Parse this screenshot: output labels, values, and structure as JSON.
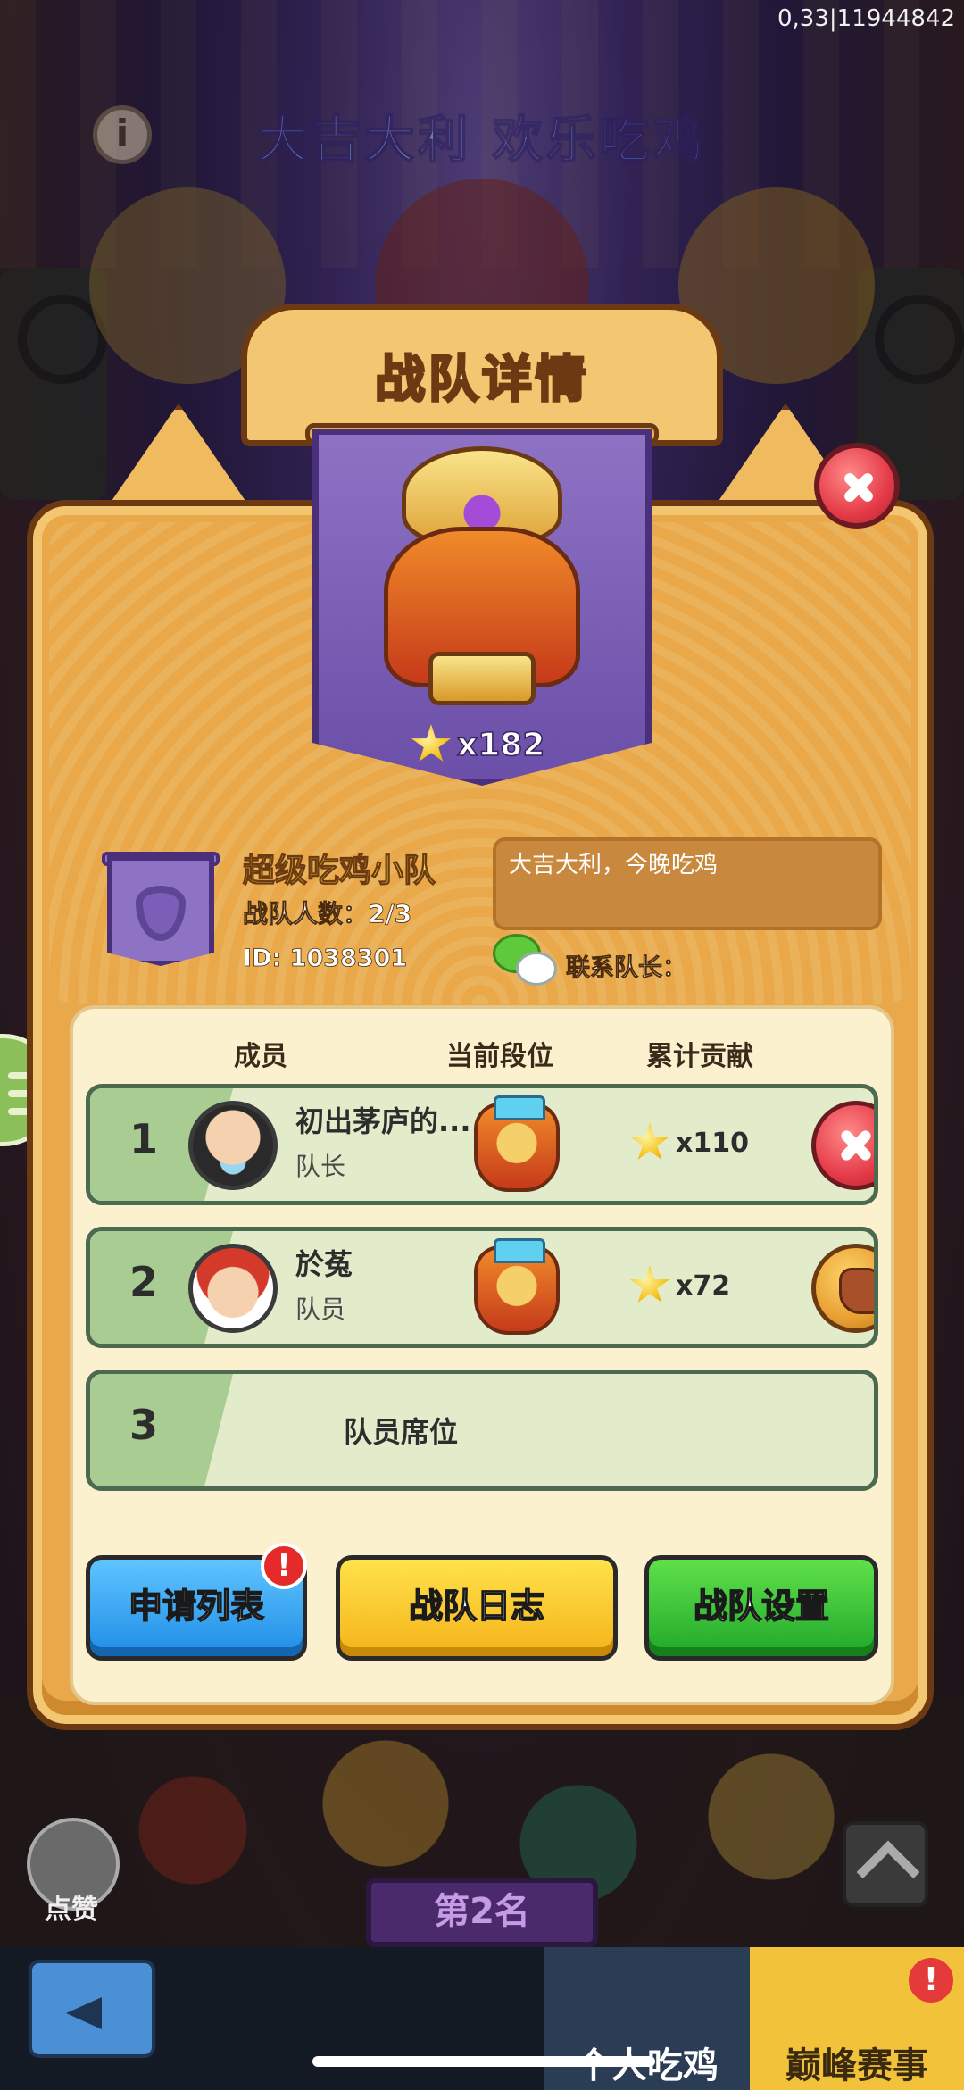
{
  "status": {
    "debug_text": "0,33|11944842"
  },
  "background": {
    "banner_text": "大吉大利 欢乐吃鸡",
    "rank_plate": "第2名",
    "like_label": "点赞"
  },
  "bottom_nav": {
    "tabs": [
      {
        "label": "个人吃鸡"
      },
      {
        "label": "巅峰赛事",
        "badge": "!"
      }
    ]
  },
  "dialog": {
    "title": "战队详情",
    "team_star_count": "x182",
    "team_name": "超级吃鸡小队",
    "member_count": "战队人数：2/3",
    "team_id": "ID: 1038301",
    "motto": "大吉大利，今晚吃鸡",
    "contact_label": "联系队长：",
    "columns": {
      "member": "成员",
      "rank": "当前段位",
      "contribution": "累计贡献"
    },
    "members": [
      {
        "num": "1",
        "name": "初出茅庐的...",
        "role": "队长",
        "contribution": "x110"
      },
      {
        "num": "2",
        "name": "於菟",
        "role": "队员",
        "contribution": "x72"
      }
    ],
    "empty_seat": {
      "num": "3",
      "label": "队员席位"
    },
    "buttons": {
      "apply_list": "申请列表",
      "apply_badge": "!",
      "team_log": "战队日志",
      "team_settings": "战队设置"
    }
  }
}
